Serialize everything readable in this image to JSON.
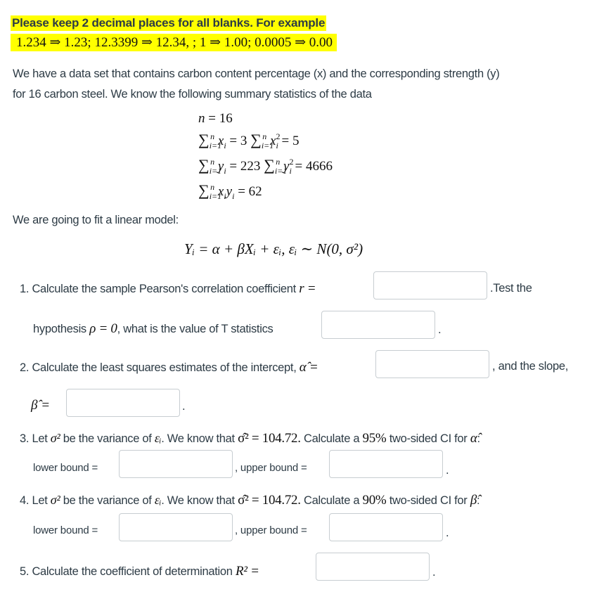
{
  "notice": {
    "title": "Please keep 2 decimal places for all blanks. For example",
    "example": "1.234 ⇒ 1.23;  12.3399 ⇒ 12.34, ;  1 ⇒ 1.00;  0.0005 ⇒ 0.00"
  },
  "intro": {
    "line1": "We have a data set that contains carbon content percentage (x) and the corresponding strength (y)",
    "line2": "for 16 carbon steel. We know the following summary statistics of the data"
  },
  "stats": {
    "n": "16",
    "sum_x": "3",
    "sum_x2": "5",
    "sum_y": "223",
    "sum_y2": "4666",
    "sum_xy": "62"
  },
  "model": {
    "lead": "We are going to fit a linear model:",
    "equation": "Yᵢ = α + βXᵢ + εᵢ,  εᵢ ∼ N(0, σ²)"
  },
  "questions": {
    "q1": {
      "text_a": "1. Calculate the sample Pearson's correlation coefficient",
      "math_a": "r =",
      "text_b": ".Test the",
      "text_c": "hypothesis",
      "math_c": "ρ = 0",
      "text_d": ", what is the value of T statistics",
      "end": ".",
      "answer_r": "",
      "answer_t": ""
    },
    "q2": {
      "text_a": "2. Calculate the least squares estimates of the intercept,",
      "math_a": "α̂ =",
      "text_b": ", and the slope,",
      "math_b": "β̂ =",
      "end": ".",
      "answer_alpha": "",
      "answer_beta": ""
    },
    "q3": {
      "text_a": "3. Let",
      "math_a": "σ²",
      "text_b": "be the variance of",
      "math_b": "εᵢ",
      "text_c": ". We know that",
      "math_c": "σ̂² = 104.72.",
      "text_d": "Calculate a",
      "math_d": "95%",
      "text_e": "two-sided CI for",
      "math_e": "α̂",
      "text_f": ":",
      "lower_label": "lower bound =",
      "upper_label": ", upper bound =",
      "end": ".",
      "lower": "",
      "upper": ""
    },
    "q4": {
      "text_a": "4. Let",
      "math_a": "σ²",
      "text_b": "be the variance of",
      "math_b": "εᵢ",
      "text_c": ". We know that",
      "math_c": "σ̂² = 104.72.",
      "text_d": "Calculate a",
      "math_d": "90%",
      "text_e": "two-sided CI for",
      "math_e": "β̂",
      "text_f": ":",
      "lower_label": "lower bound =",
      "upper_label": ", upper bound =",
      "end": ".",
      "lower": "",
      "upper": ""
    },
    "q5": {
      "text_a": "5. Calculate the coefficient of determination",
      "math_a": "R² =",
      "end": ".",
      "answer": ""
    }
  }
}
